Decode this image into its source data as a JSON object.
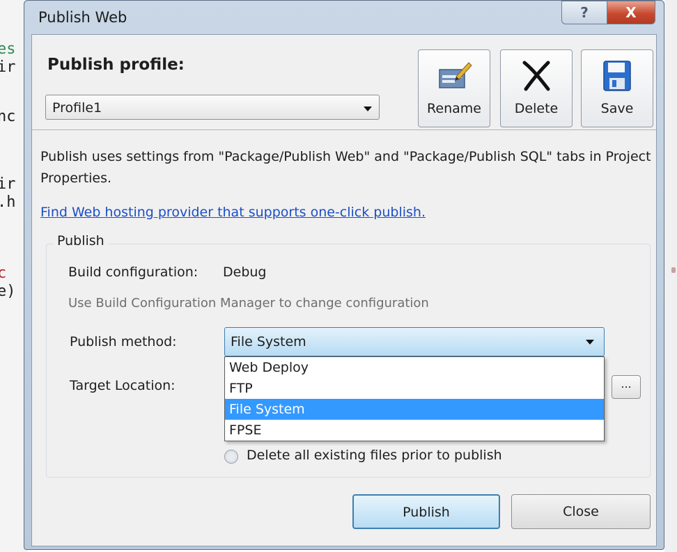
{
  "background_code": {
    "lines": [
      "es",
      "ir",
      "nc",
      "ir",
      ".h",
      "c",
      "e)"
    ]
  },
  "window": {
    "title": "Publish Web",
    "help_label": "?",
    "close_label": "X"
  },
  "profile": {
    "heading": "Publish profile:",
    "selected": "Profile1",
    "rename_label": "Rename",
    "delete_label": "Delete",
    "save_label": "Save"
  },
  "info": {
    "text": "Publish uses settings from \"Package/Publish Web\" and \"Package/Publish SQL\" tabs in Project Properties.",
    "link": "Find Web hosting provider that supports one-click publish."
  },
  "publish_group": {
    "title": "Publish",
    "build_config_label": "Build configuration:",
    "build_config_value": "Debug",
    "build_config_hint": "Use Build Configuration Manager to change configuration",
    "method_label": "Publish method:",
    "method_value": "File System",
    "method_options": [
      "Web Deploy",
      "FTP",
      "File System",
      "FPSE"
    ],
    "method_selected_index": 2,
    "target_label": "Target Location:",
    "browse_label": "...",
    "delete_files_label": "Delete all existing files prior to publish"
  },
  "buttons": {
    "publish": "Publish",
    "close": "Close"
  },
  "colors": {
    "selection": "#3399ff",
    "link": "#1a4fc7",
    "close_button": "#c84a30"
  }
}
